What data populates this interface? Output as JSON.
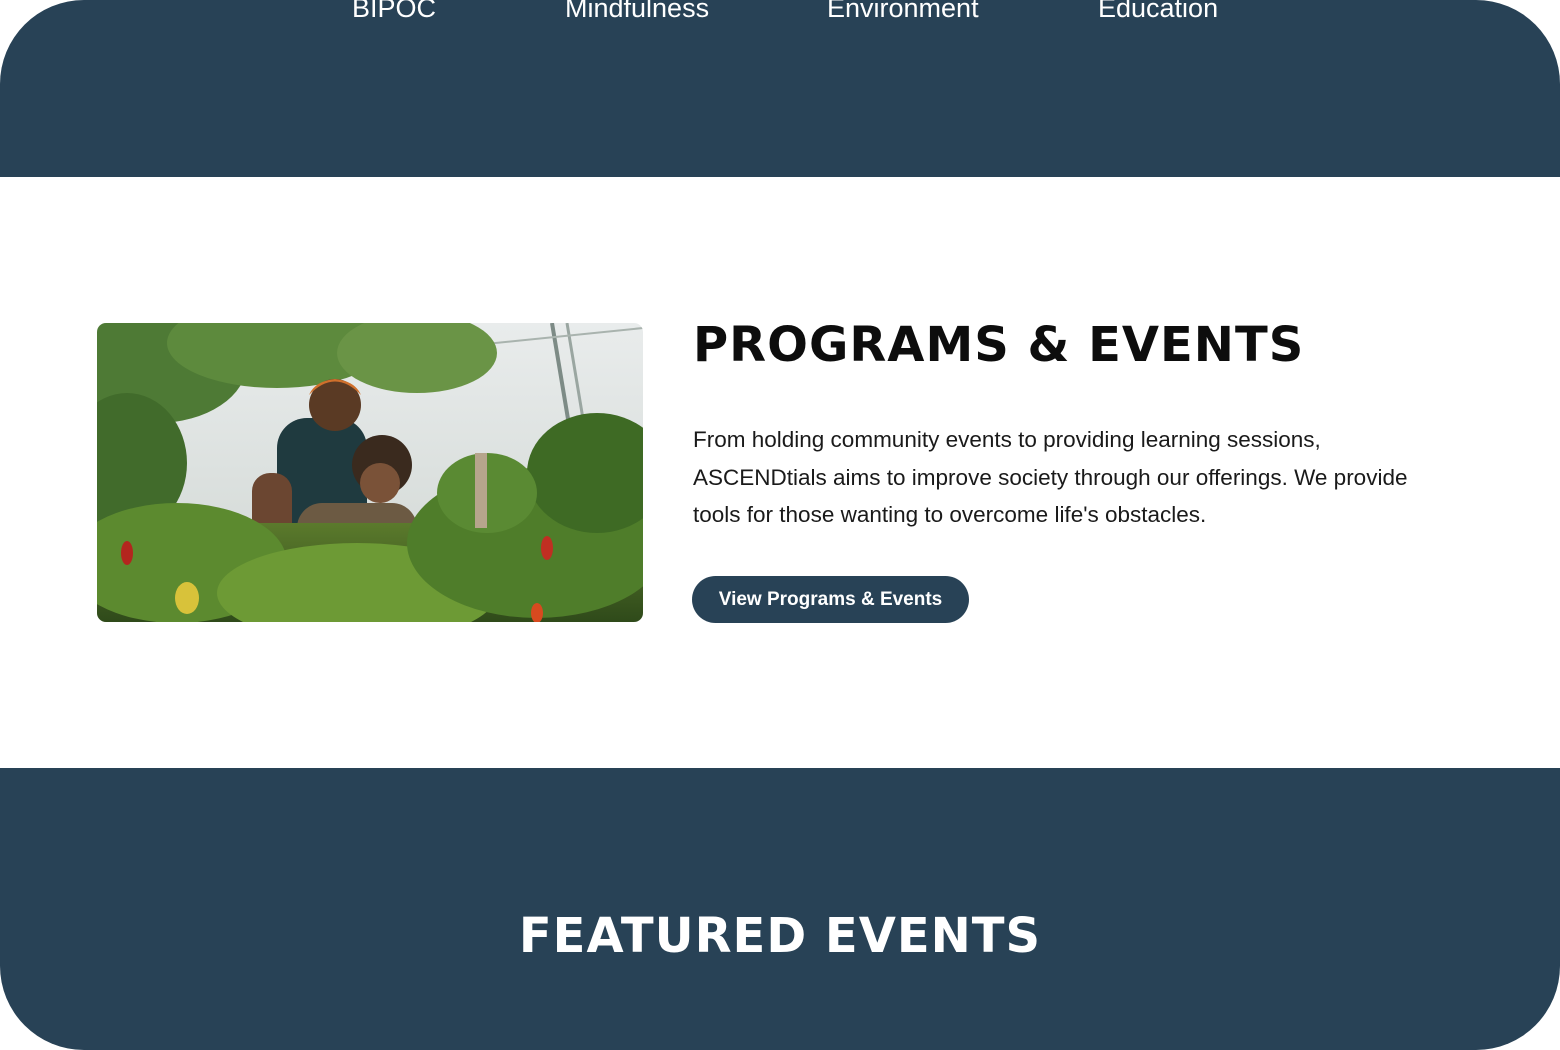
{
  "category_nav": {
    "items": [
      {
        "label": "BIPOC"
      },
      {
        "label": "Mindfulness"
      },
      {
        "label": "Environment"
      },
      {
        "label": "Education"
      }
    ]
  },
  "programs_section": {
    "title": "PROGRAMS & EVENTS",
    "description": "From holding community events to providing learning sessions, ASCENDtials aims to improve society through our offerings. We provide tools for those wanting to overcome life's obstacles.",
    "button_label": "View Programs & Events",
    "image_icon": "garden-photo"
  },
  "featured_section": {
    "title": "FEATURED EVENTS"
  },
  "colors": {
    "brand_navy": "#284256",
    "background": "#ffffff",
    "heading_text": "#0d0d0d"
  }
}
